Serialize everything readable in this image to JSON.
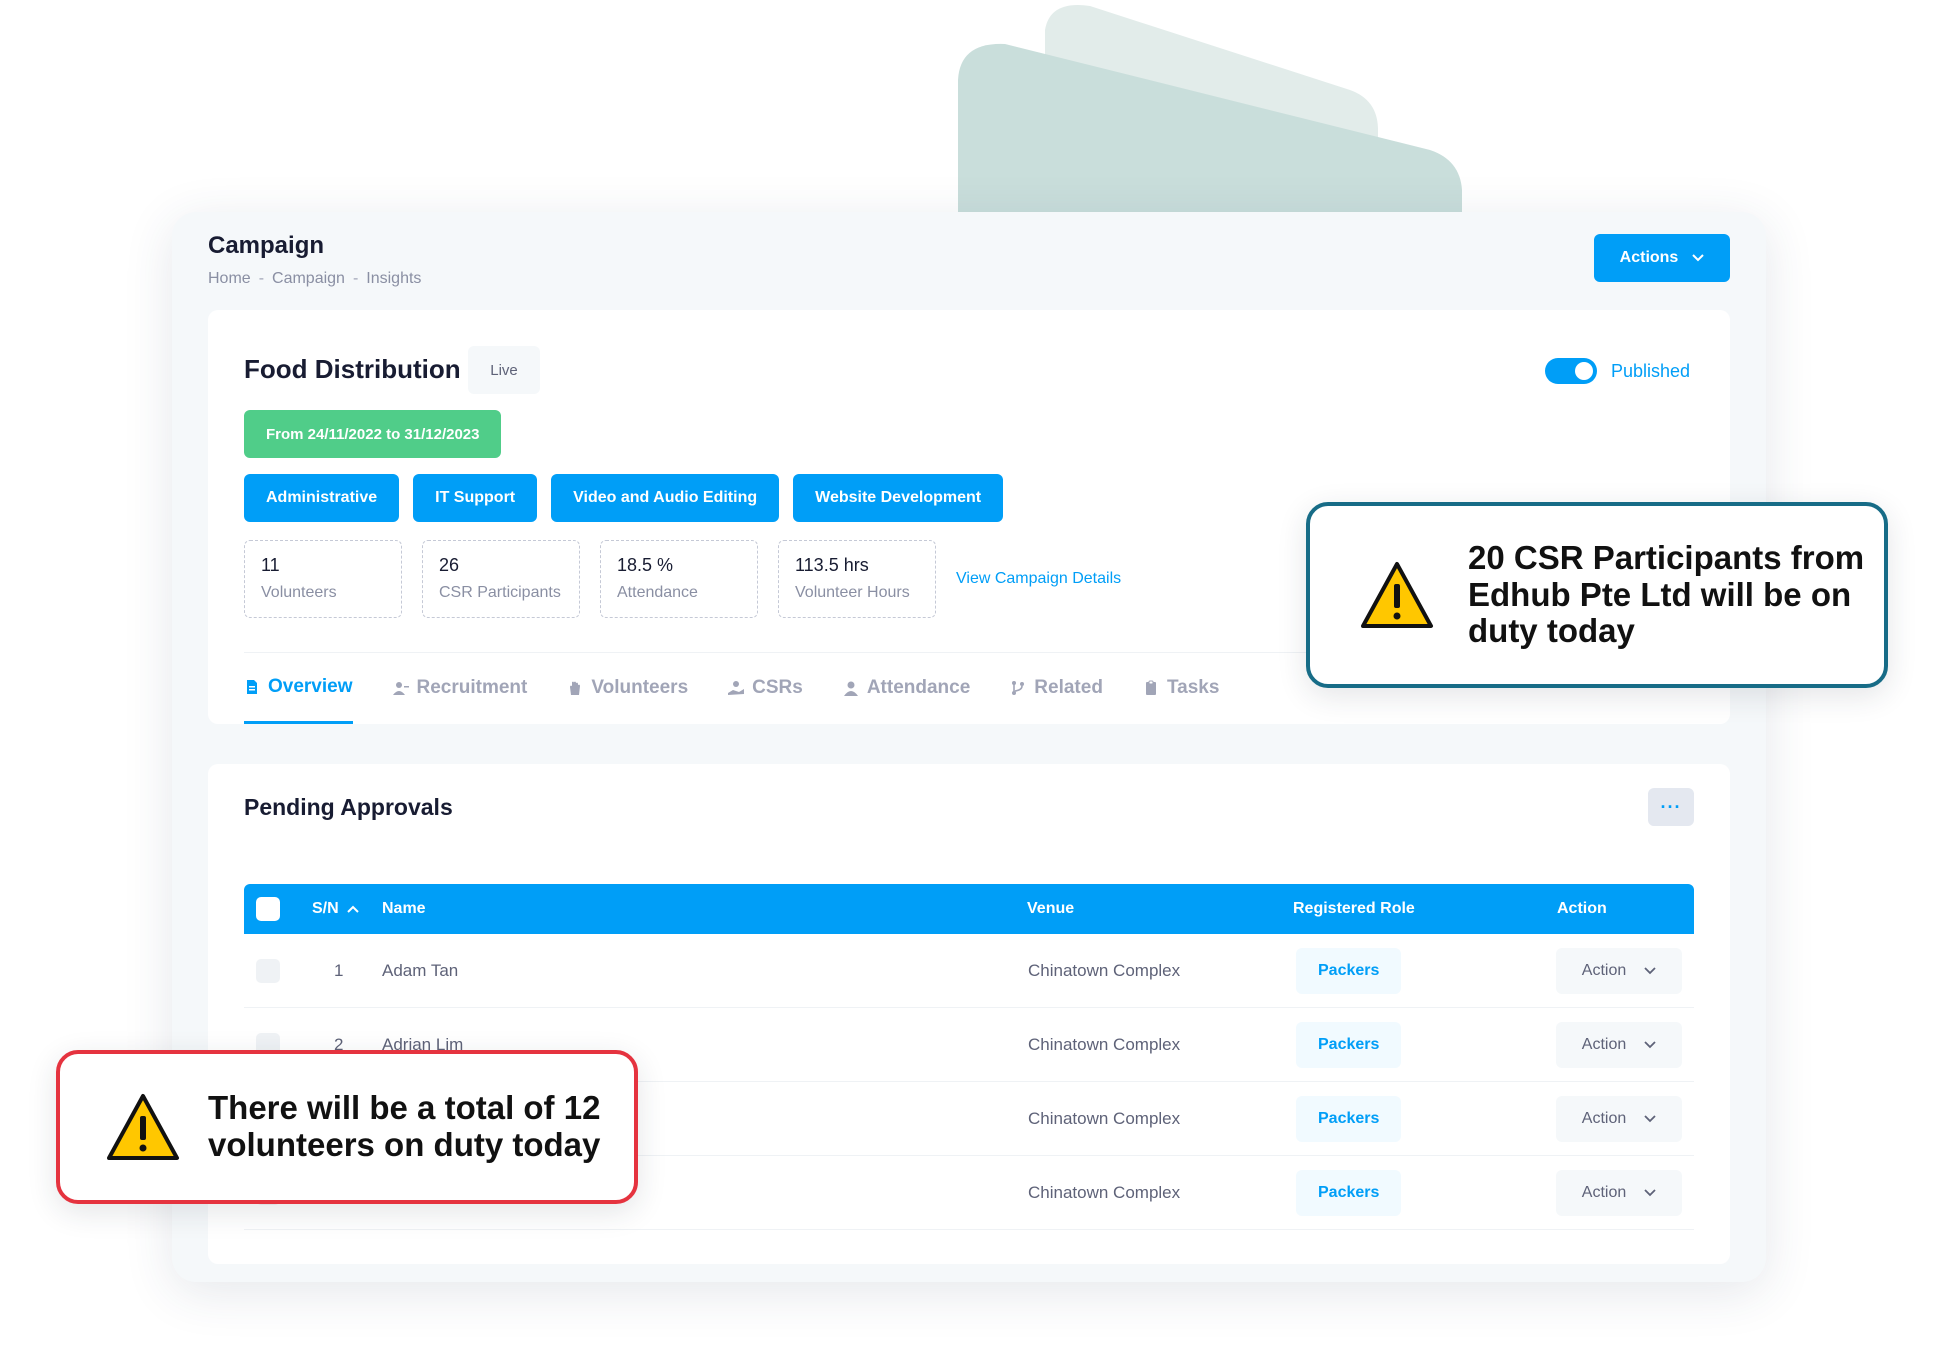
{
  "page": {
    "title": "Campaign",
    "breadcrumb": [
      "Home",
      "Campaign",
      "Insights"
    ],
    "actions_label": "Actions"
  },
  "campaign": {
    "name": "Food Distribution",
    "status": "Live",
    "published_label": "Published",
    "published": true,
    "date_range": "From 24/11/2022 to 31/12/2023",
    "skills": [
      "Administrative",
      "IT Support",
      "Video and Audio Editing",
      "Website Development"
    ],
    "stats": [
      {
        "value": "11",
        "label": "Volunteers"
      },
      {
        "value": "26",
        "label": "CSR Participants"
      },
      {
        "value": "18.5 %",
        "label": "Attendance"
      },
      {
        "value": "113.5 hrs",
        "label": "Volunteer Hours"
      }
    ],
    "view_details_label": "View Campaign Details",
    "tabs": [
      {
        "label": "Overview",
        "icon": "document-icon",
        "active": true
      },
      {
        "label": "Recruitment",
        "icon": "user-add-icon",
        "active": false
      },
      {
        "label": "Volunteers",
        "icon": "hand-icon",
        "active": false
      },
      {
        "label": "CSRs",
        "icon": "handshake-icon",
        "active": false
      },
      {
        "label": "Attendance",
        "icon": "user-icon",
        "active": false
      },
      {
        "label": "Related",
        "icon": "branch-icon",
        "active": false
      },
      {
        "label": "Tasks",
        "icon": "clipboard-icon",
        "active": false
      }
    ]
  },
  "approvals": {
    "title": "Pending Approvals",
    "more_label": "···",
    "columns": {
      "sn": "S/N",
      "name": "Name",
      "venue": "Venue",
      "role": "Registered Role",
      "action": "Action"
    },
    "rows": [
      {
        "sn": "1",
        "name": "Adam Tan",
        "venue": "Chinatown Complex",
        "role": "Packers",
        "action": "Action"
      },
      {
        "sn": "2",
        "name": "Adrian Lim",
        "venue": "Chinatown Complex",
        "role": "Packers",
        "action": "Action"
      },
      {
        "sn": "",
        "name": "",
        "venue": "Chinatown Complex",
        "role": "Packers",
        "action": "Action"
      },
      {
        "sn": "",
        "name": "",
        "venue": "Chinatown Complex",
        "role": "Packers",
        "action": "Action"
      }
    ]
  },
  "callouts": {
    "csr": "20 CSR Participants from Edhub Pte Ltd will be on duty today",
    "volunteers": "There will be a total of 12 volunteers on duty today"
  },
  "colors": {
    "primary": "#009ef7",
    "success": "#50cd89",
    "callout_csr_border": "#176c87",
    "callout_vol_border": "#e5333f",
    "warning": "#ffc700"
  }
}
